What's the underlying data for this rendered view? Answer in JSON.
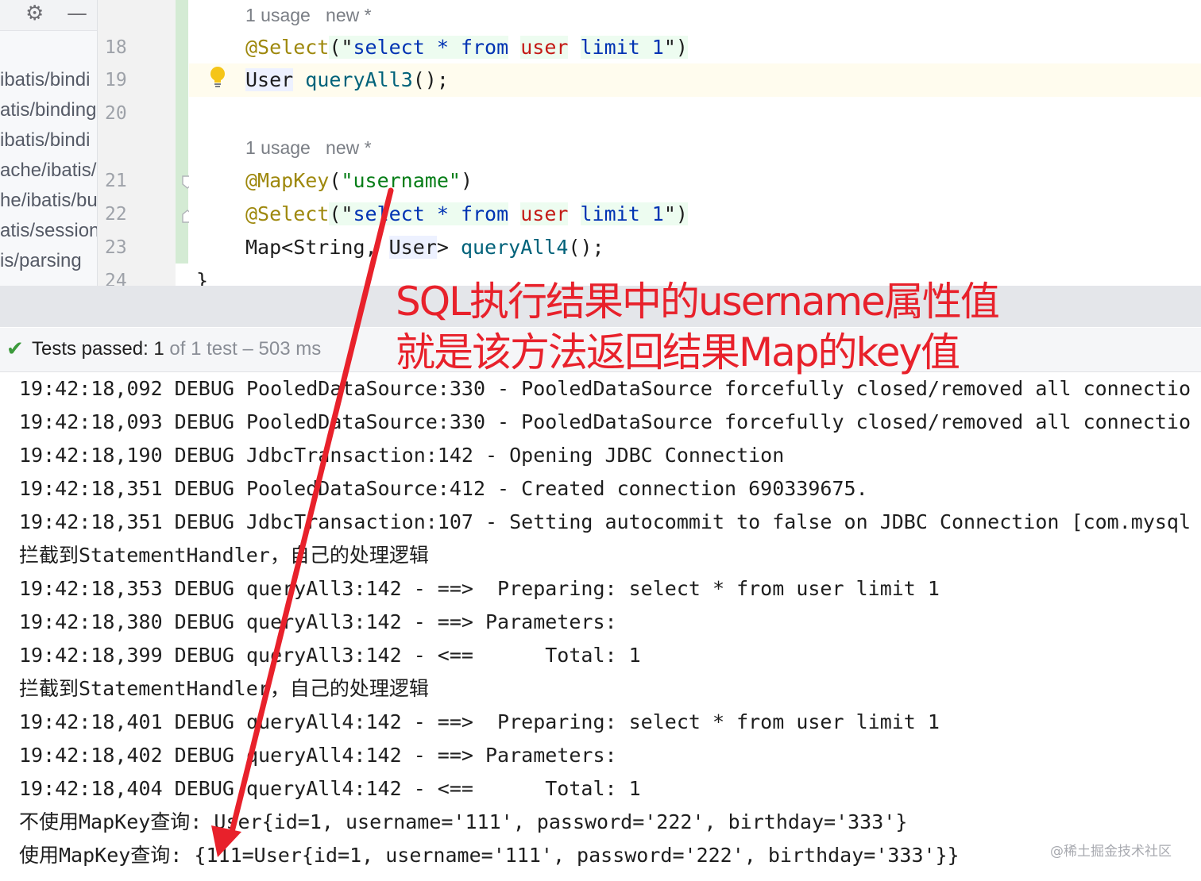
{
  "project_tree": {
    "items": [
      "ibatis/bindi",
      "atis/binding",
      "ibatis/bindi",
      "ache/ibatis/",
      "he/ibatis/bu",
      "atis/session",
      "is/parsing"
    ]
  },
  "toolbar": {
    "settings_icon": "gear-icon",
    "minimize_icon": "minus-icon"
  },
  "editor": {
    "line_numbers": [
      "18",
      "19",
      "20",
      "21",
      "22",
      "23",
      "24"
    ],
    "hints": [
      {
        "usage": "1 usage",
        "status": "new *"
      },
      {
        "usage": "1 usage",
        "status": "new *"
      }
    ],
    "lines": {
      "l18": {
        "ann": "@Select",
        "p1": "(\"",
        "sql1": "select * ",
        "sql2": "from",
        "sql3": " ",
        "sql4": "user",
        "sql5": " ",
        "sql6": "limit 1",
        "p2": "\")"
      },
      "l19": {
        "type": "User",
        "sp": " ",
        "fn": "queryAll3",
        "rest": "();"
      },
      "l21": {
        "ann": "@MapKey",
        "p1": "(",
        "str": "\"username\"",
        "p2": ")"
      },
      "l22": {
        "ann": "@Select",
        "p1": "(\"",
        "sql1": "select * ",
        "sql2": "from",
        "sql3": " ",
        "sql4": "user",
        "sql5": " ",
        "sql6": "limit 1",
        "p2": "\")"
      },
      "l23": {
        "p1": "Map<String, ",
        "type": "User",
        "p2": "> ",
        "fn": "queryAll4",
        "rest": "();"
      },
      "l24": "}"
    },
    "bulb_icon": "lightbulb-icon"
  },
  "test_status": {
    "icon": "check-icon",
    "label": "Tests passed: 1",
    "meta": " of 1 test – 503 ms"
  },
  "console": {
    "lines": [
      "19:42:18,092 DEBUG PooledDataSource:330 - PooledDataSource forcefully closed/removed all connectio",
      "19:42:18,093 DEBUG PooledDataSource:330 - PooledDataSource forcefully closed/removed all connectio",
      "19:42:18,190 DEBUG JdbcTransaction:142 - Opening JDBC Connection",
      "19:42:18,351 DEBUG PooledDataSource:412 - Created connection 690339675.",
      "19:42:18,351 DEBUG JdbcTransaction:107 - Setting autocommit to false on JDBC Connection [com.mysql",
      "拦截到StatementHandler，自己的处理逻辑",
      "19:42:18,353 DEBUG queryAll3:142 - ==>  Preparing: select * from user limit 1",
      "19:42:18,380 DEBUG queryAll3:142 - ==> Parameters: ",
      "19:42:18,399 DEBUG queryAll3:142 - <==      Total: 1",
      "拦截到StatementHandler，自己的处理逻辑",
      "19:42:18,401 DEBUG queryAll4:142 - ==>  Preparing: select * from user limit 1",
      "19:42:18,402 DEBUG queryAll4:142 - ==> Parameters: ",
      "19:42:18,404 DEBUG queryAll4:142 - <==      Total: 1",
      "不使用MapKey查询: User{id=1, username='111', password='222', birthday='333'}",
      "使用MapKey查询: {111=User{id=1, username='111', password='222', birthday='333'}}"
    ]
  },
  "annotation": {
    "line1": "SQL执行结果中的username属性值",
    "line2": "就是该方法返回结果Map的key值",
    "color": "#e8212b"
  },
  "watermark": "@稀土掘金技术社区"
}
